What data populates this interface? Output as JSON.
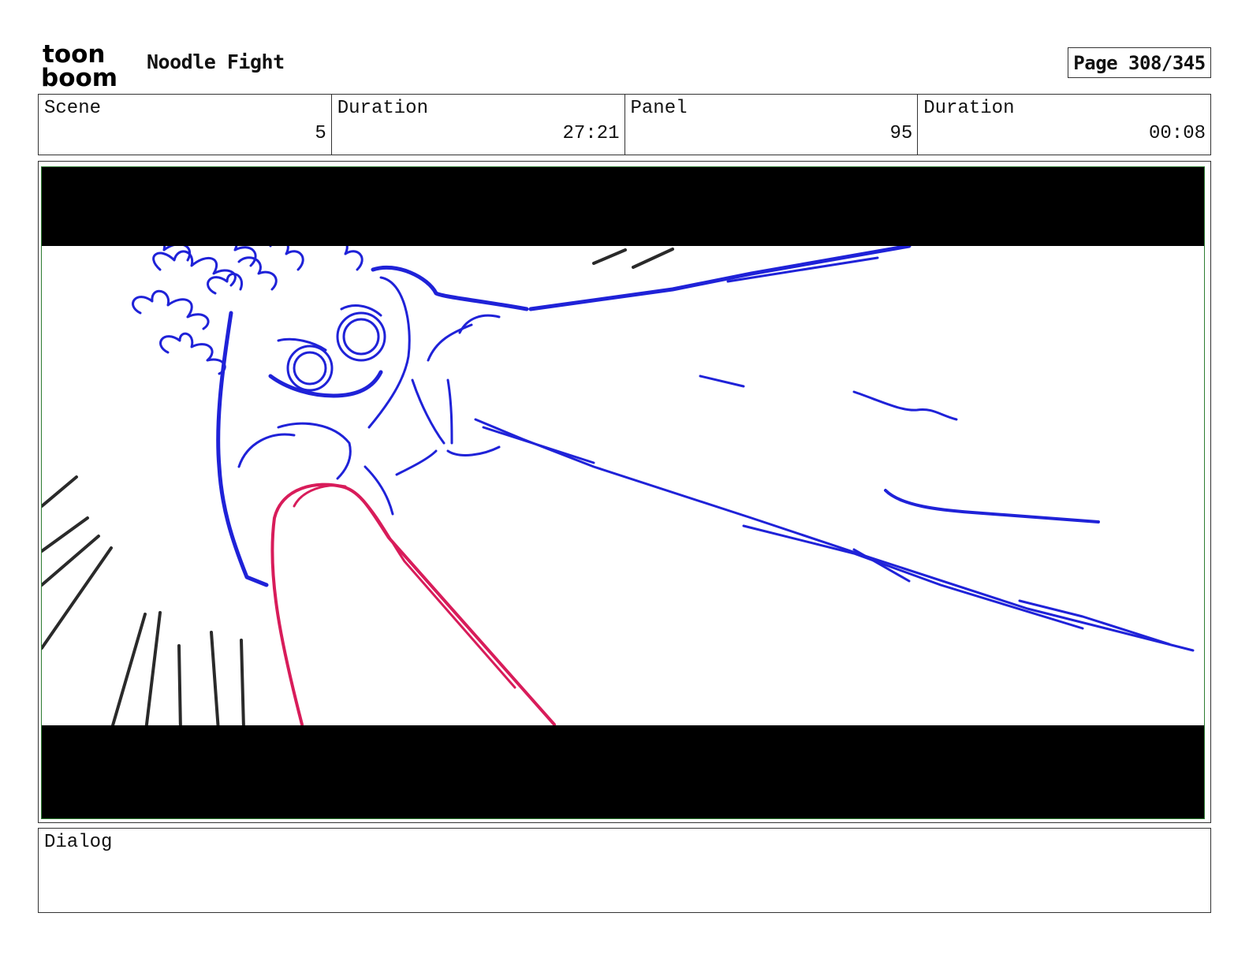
{
  "header": {
    "logo_text_top": "toon",
    "logo_text_bottom": "boom",
    "project_title": "Noodle Fight",
    "page_indicator": "Page 308/345"
  },
  "info": {
    "scene_label": "Scene",
    "scene_value": "5",
    "scene_duration_label": "Duration",
    "scene_duration_value": "27:21",
    "panel_label": "Panel",
    "panel_value": "95",
    "panel_duration_label": "Duration",
    "panel_duration_value": "00:08"
  },
  "panel": {
    "letterbox_color": "#000000",
    "frame_color": "#2e7d32",
    "sketch_colors": {
      "character": "#1f22d8",
      "tongue": "#d81c5a",
      "speed_lines": "#2a2a2a"
    }
  },
  "dialog": {
    "label": "Dialog",
    "text": ""
  }
}
